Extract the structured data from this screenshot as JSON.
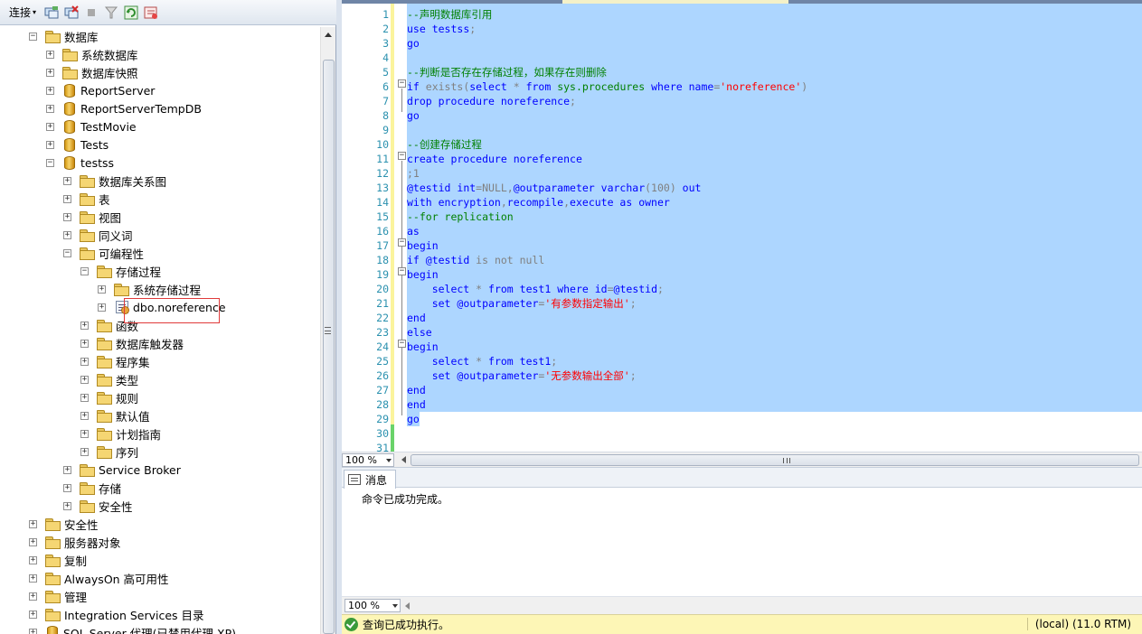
{
  "toolbar": {
    "connect_label": "连接",
    "icons": [
      "connect-object-explorer-icon",
      "disconnect-icon",
      "stop-icon",
      "filter-icon",
      "refresh-icon",
      "summary-icon"
    ]
  },
  "tree": {
    "items": [
      {
        "label": "数据库",
        "level": 0,
        "expanded": true,
        "icon": "folder"
      },
      {
        "label": "系统数据库",
        "level": 1,
        "expanded": false,
        "icon": "folder"
      },
      {
        "label": "数据库快照",
        "level": 1,
        "expanded": false,
        "icon": "folder"
      },
      {
        "label": "ReportServer",
        "level": 1,
        "expanded": false,
        "icon": "database"
      },
      {
        "label": "ReportServerTempDB",
        "level": 1,
        "expanded": false,
        "icon": "database"
      },
      {
        "label": "TestMovie",
        "level": 1,
        "expanded": false,
        "icon": "database"
      },
      {
        "label": "Tests",
        "level": 1,
        "expanded": false,
        "icon": "database"
      },
      {
        "label": "testss",
        "level": 1,
        "expanded": true,
        "icon": "database"
      },
      {
        "label": "数据库关系图",
        "level": 2,
        "expanded": false,
        "icon": "folder"
      },
      {
        "label": "表",
        "level": 2,
        "expanded": false,
        "icon": "folder"
      },
      {
        "label": "视图",
        "level": 2,
        "expanded": false,
        "icon": "folder"
      },
      {
        "label": "同义词",
        "level": 2,
        "expanded": false,
        "icon": "folder"
      },
      {
        "label": "可编程性",
        "level": 2,
        "expanded": true,
        "icon": "folder"
      },
      {
        "label": "存储过程",
        "level": 3,
        "expanded": true,
        "icon": "folder"
      },
      {
        "label": "系统存储过程",
        "level": 4,
        "expanded": false,
        "icon": "folder"
      },
      {
        "label": "dbo.noreference",
        "level": 4,
        "expanded": false,
        "icon": "stored-procedure"
      },
      {
        "label": "函数",
        "level": 3,
        "expanded": false,
        "icon": "folder"
      },
      {
        "label": "数据库触发器",
        "level": 3,
        "expanded": false,
        "icon": "folder"
      },
      {
        "label": "程序集",
        "level": 3,
        "expanded": false,
        "icon": "folder"
      },
      {
        "label": "类型",
        "level": 3,
        "expanded": false,
        "icon": "folder"
      },
      {
        "label": "规则",
        "level": 3,
        "expanded": false,
        "icon": "folder"
      },
      {
        "label": "默认值",
        "level": 3,
        "expanded": false,
        "icon": "folder"
      },
      {
        "label": "计划指南",
        "level": 3,
        "expanded": false,
        "icon": "folder"
      },
      {
        "label": "序列",
        "level": 3,
        "expanded": false,
        "icon": "folder"
      },
      {
        "label": "Service Broker",
        "level": 2,
        "expanded": false,
        "icon": "folder"
      },
      {
        "label": "存储",
        "level": 2,
        "expanded": false,
        "icon": "folder"
      },
      {
        "label": "安全性",
        "level": 2,
        "expanded": false,
        "icon": "folder"
      },
      {
        "label": "安全性",
        "level": 0,
        "expanded": false,
        "icon": "folder"
      },
      {
        "label": "服务器对象",
        "level": 0,
        "expanded": false,
        "icon": "folder"
      },
      {
        "label": "复制",
        "level": 0,
        "expanded": false,
        "icon": "folder"
      },
      {
        "label": "AlwaysOn 高可用性",
        "level": 0,
        "expanded": false,
        "icon": "folder"
      },
      {
        "label": "管理",
        "level": 0,
        "expanded": false,
        "icon": "folder"
      },
      {
        "label": "Integration Services 目录",
        "level": 0,
        "expanded": false,
        "icon": "folder"
      },
      {
        "label": "SQL Server 代理(已禁用代理 XP)",
        "level": 0,
        "expanded": false,
        "icon": "agent"
      }
    ]
  },
  "editor": {
    "lines": [
      [
        [
          "cm",
          "--声明数据库引用"
        ]
      ],
      [
        [
          "kw",
          "use "
        ],
        [
          "id",
          "testss"
        ],
        [
          "gr",
          ";"
        ]
      ],
      [
        [
          "kw",
          "go"
        ]
      ],
      [],
      [
        [
          "cm",
          "--判断是否存在存储过程，如果存在则删除"
        ]
      ],
      [
        [
          "kw",
          "if "
        ],
        [
          "gr",
          "exists("
        ],
        [
          "kw",
          "select "
        ],
        [
          "gr",
          "* "
        ],
        [
          "kw",
          "from "
        ],
        [
          "sy",
          "sys.procedures "
        ],
        [
          "kw",
          "where "
        ],
        [
          "id",
          "name"
        ],
        [
          "gr",
          "="
        ],
        [
          "st",
          "'noreference'"
        ],
        [
          "gr",
          ")"
        ]
      ],
      [
        [
          "kw",
          "drop procedure "
        ],
        [
          "id",
          "noreference"
        ],
        [
          "gr",
          ";"
        ]
      ],
      [
        [
          "kw",
          "go"
        ]
      ],
      [],
      [
        [
          "cm",
          "--创建存储过程"
        ]
      ],
      [
        [
          "kw",
          "create procedure "
        ],
        [
          "id",
          "noreference"
        ]
      ],
      [
        [
          "gr",
          ";1"
        ]
      ],
      [
        [
          "id",
          "@testid "
        ],
        [
          "kw",
          "int"
        ],
        [
          "gr",
          "=NULL,"
        ],
        [
          "id",
          "@outparameter "
        ],
        [
          "kw",
          "varchar"
        ],
        [
          "gr",
          "(100) "
        ],
        [
          "kw",
          "out"
        ]
      ],
      [
        [
          "kw",
          "with encryption"
        ],
        [
          "gr",
          ","
        ],
        [
          "kw",
          "recompile"
        ],
        [
          "gr",
          ","
        ],
        [
          "kw",
          "execute as owner"
        ]
      ],
      [
        [
          "cm",
          "--for replication"
        ]
      ],
      [
        [
          "kw",
          "as"
        ]
      ],
      [
        [
          "kw",
          "begin"
        ]
      ],
      [
        [
          "kw",
          "if "
        ],
        [
          "id",
          "@testid "
        ],
        [
          "gr",
          "is not null"
        ]
      ],
      [
        [
          "kw",
          "begin"
        ]
      ],
      [
        [
          "kw",
          "    select "
        ],
        [
          "gr",
          "* "
        ],
        [
          "kw",
          "from "
        ],
        [
          "id",
          "test1 "
        ],
        [
          "kw",
          "where "
        ],
        [
          "id",
          "id"
        ],
        [
          "gr",
          "="
        ],
        [
          "id",
          "@testid"
        ],
        [
          "gr",
          ";"
        ]
      ],
      [
        [
          "kw",
          "    set "
        ],
        [
          "id",
          "@outparameter"
        ],
        [
          "gr",
          "="
        ],
        [
          "st",
          "'有参数指定输出'"
        ],
        [
          "gr",
          ";"
        ]
      ],
      [
        [
          "kw",
          "end"
        ]
      ],
      [
        [
          "kw",
          "else"
        ]
      ],
      [
        [
          "kw",
          "begin"
        ]
      ],
      [
        [
          "kw",
          "    select "
        ],
        [
          "gr",
          "* "
        ],
        [
          "kw",
          "from "
        ],
        [
          "id",
          "test1"
        ],
        [
          "gr",
          ";"
        ]
      ],
      [
        [
          "kw",
          "    set "
        ],
        [
          "id",
          "@outparameter"
        ],
        [
          "gr",
          "="
        ],
        [
          "st",
          "'无参数输出全部'"
        ],
        [
          "gr",
          ";"
        ]
      ],
      [
        [
          "kw",
          "end"
        ]
      ],
      [
        [
          "kw",
          "end"
        ]
      ],
      [
        [
          "kw",
          "go"
        ]
      ],
      [],
      []
    ],
    "line_numbers": [
      "1",
      "2",
      "3",
      "4",
      "5",
      "6",
      "7",
      "8",
      "9",
      "10",
      "11",
      "12",
      "13",
      "14",
      "15",
      "16",
      "17",
      "18",
      "19",
      "20",
      "21",
      "22",
      "23",
      "24",
      "25",
      "26",
      "27",
      "28",
      "29",
      "30",
      "31"
    ],
    "zoom_label": "100 %"
  },
  "results": {
    "tab_label": "消息",
    "message": "命令已成功完成。",
    "zoom_label": "100 %"
  },
  "status": {
    "text": "查询已成功执行。",
    "server": "(local) (11.0 RTM)"
  },
  "colors": {
    "selection": "#add6ff",
    "keyword": "#0000ff",
    "comment": "#008000",
    "string": "#ff0000",
    "gray": "#808080",
    "status_bg": "#fdf6b6",
    "highlight_box": "#e03b3b"
  }
}
